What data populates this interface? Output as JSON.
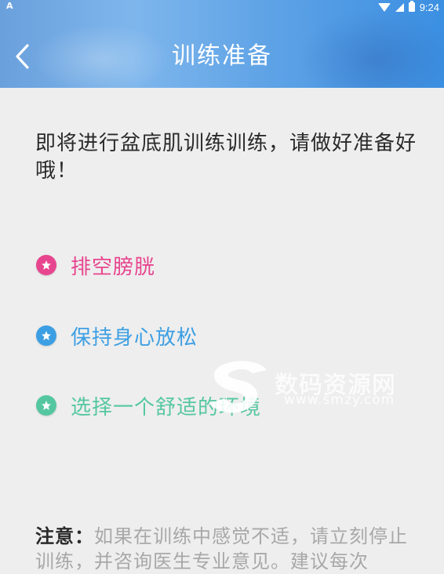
{
  "status_bar": {
    "left_icon": "A",
    "time": "9:24",
    "icons": [
      "wifi-icon",
      "signal-icon",
      "battery-icon"
    ]
  },
  "header": {
    "title": "训练准备",
    "back_icon": "chevron-left-icon"
  },
  "intro_text": "即将进行盆底肌训练训练，请做好准备好哦！",
  "items": [
    {
      "label": "排空膀胱",
      "color": "#e8458f",
      "icon": "star-icon"
    },
    {
      "label": "保持身心放松",
      "color": "#3d9fe3",
      "icon": "star-icon"
    },
    {
      "label": "选择一个舒适的环境",
      "color": "#55c7a0",
      "icon": "star-icon"
    }
  ],
  "watermark": {
    "text": "数码资源网",
    "url": "www.smzy.com"
  },
  "note": {
    "label": "注意：",
    "text": "如果在训练中感觉不适，请立刻停止训练，并咨询医生专业意见。建议每次"
  }
}
